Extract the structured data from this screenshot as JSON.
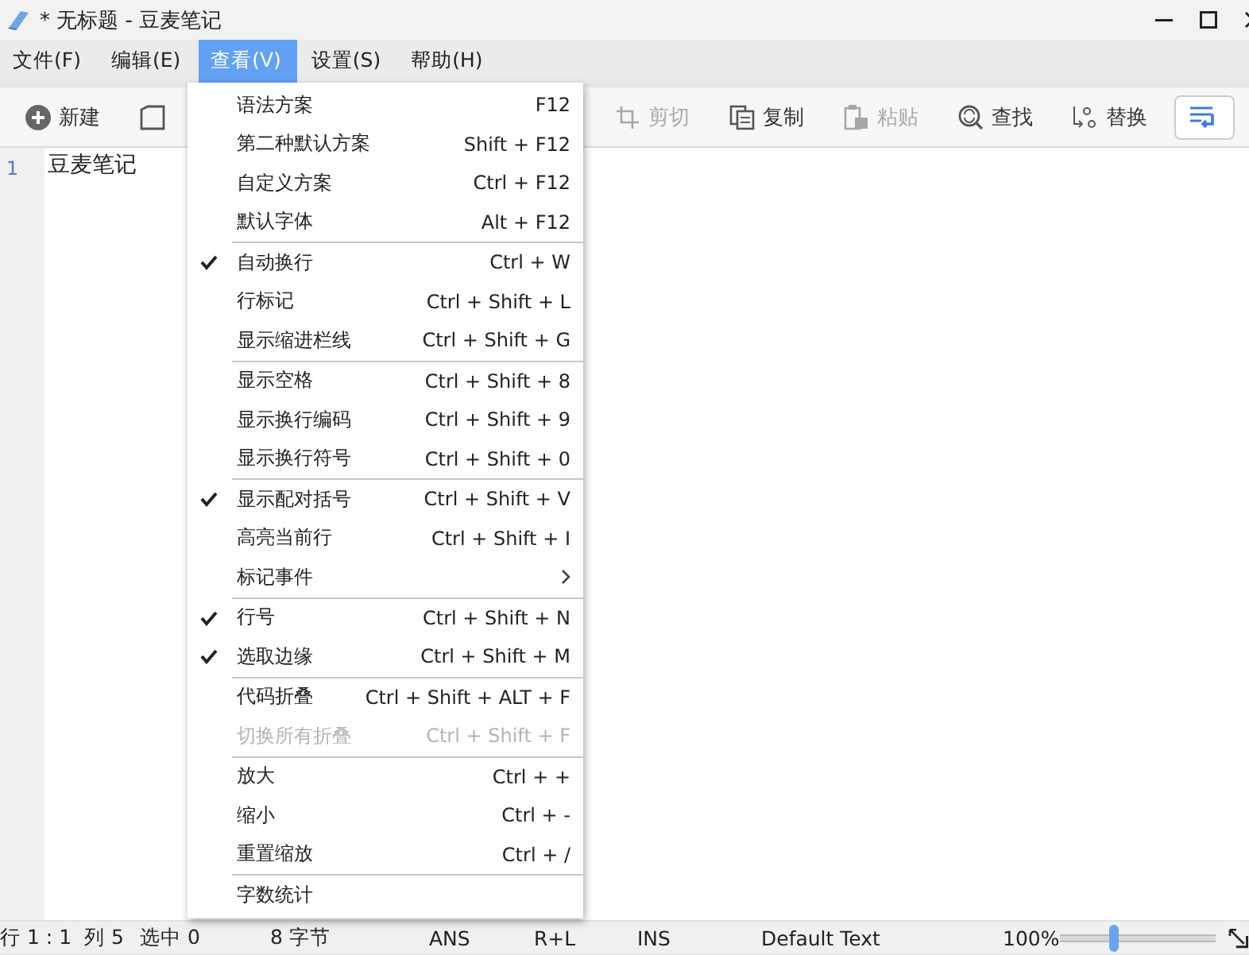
{
  "window": {
    "title": "* 无标题 - 豆麦笔记"
  },
  "menubar": [
    {
      "label": "文件(F)",
      "selected": false
    },
    {
      "label": "编辑(E)",
      "selected": false
    },
    {
      "label": "查看(V)",
      "selected": true
    },
    {
      "label": "设置(S)",
      "selected": false
    },
    {
      "label": "帮助(H)",
      "selected": false
    }
  ],
  "toolbar": [
    {
      "label": "新建",
      "disabled": false
    },
    {
      "disabled": false
    },
    {
      "label": "剪切",
      "disabled": true
    },
    {
      "label": "复制",
      "disabled": false
    },
    {
      "label": "粘贴",
      "disabled": true
    },
    {
      "label": "查找",
      "disabled": false
    },
    {
      "label": "替换",
      "disabled": false
    },
    {
      "disabled": false
    }
  ],
  "editor": {
    "lines": [
      {
        "number": "1",
        "text": "豆麦笔记"
      }
    ]
  },
  "menu": {
    "groups": [
      [
        {
          "label": "语法方案",
          "shortcut": "F12",
          "checked": false,
          "disabled": false
        },
        {
          "label": "第二种默认方案",
          "shortcut": "Shift + F12",
          "checked": false,
          "disabled": false
        },
        {
          "label": "自定义方案",
          "shortcut": "Ctrl + F12",
          "checked": false,
          "disabled": false
        },
        {
          "label": "默认字体",
          "shortcut": "Alt + F12",
          "checked": false,
          "disabled": false
        }
      ],
      [
        {
          "label": "自动换行",
          "shortcut": "Ctrl + W",
          "checked": true,
          "disabled": false
        },
        {
          "label": "行标记",
          "shortcut": "Ctrl + Shift + L",
          "checked": false,
          "disabled": false
        },
        {
          "label": "显示缩进栏线",
          "shortcut": "Ctrl + Shift + G",
          "checked": false,
          "disabled": false
        }
      ],
      [
        {
          "label": "显示空格",
          "shortcut": "Ctrl + Shift + 8",
          "checked": false,
          "disabled": false
        },
        {
          "label": "显示换行编码",
          "shortcut": "Ctrl + Shift + 9",
          "checked": false,
          "disabled": false
        },
        {
          "label": "显示换行符号",
          "shortcut": "Ctrl + Shift + 0",
          "checked": false,
          "disabled": false
        }
      ],
      [
        {
          "label": "显示配对括号",
          "shortcut": "Ctrl + Shift + V",
          "checked": true,
          "disabled": false
        },
        {
          "label": "高亮当前行",
          "shortcut": "Ctrl + Shift + I",
          "checked": false,
          "disabled": false
        },
        {
          "label": "标记事件",
          "submenu": true,
          "checked": false,
          "disabled": false
        }
      ],
      [
        {
          "label": "行号",
          "shortcut": "Ctrl + Shift + N",
          "checked": true,
          "disabled": false
        },
        {
          "label": "选取边缘",
          "shortcut": "Ctrl + Shift + M",
          "checked": true,
          "disabled": false
        }
      ],
      [
        {
          "label": "代码折叠",
          "shortcut": "Ctrl + Shift + ALT + F",
          "checked": false,
          "disabled": false
        },
        {
          "label": "切换所有折叠",
          "shortcut": "Ctrl + Shift + F",
          "checked": false,
          "disabled": true
        }
      ],
      [
        {
          "label": "放大",
          "shortcut": "Ctrl + +",
          "checked": false,
          "disabled": false
        },
        {
          "label": "缩小",
          "shortcut": "Ctrl + -",
          "checked": false,
          "disabled": false
        },
        {
          "label": "重置缩放",
          "shortcut": "Ctrl + /",
          "checked": false,
          "disabled": false
        }
      ],
      [
        {
          "label": "字数统计",
          "checked": false,
          "disabled": false
        }
      ]
    ]
  },
  "status_bar": {
    "fields": [
      "行 1 : 1",
      "列 5",
      "选中 0",
      "8 字节",
      "ANS",
      "R+L",
      "INS",
      "Default Text",
      "100%"
    ],
    "zoom": {
      "level": 0.35
    }
  }
}
